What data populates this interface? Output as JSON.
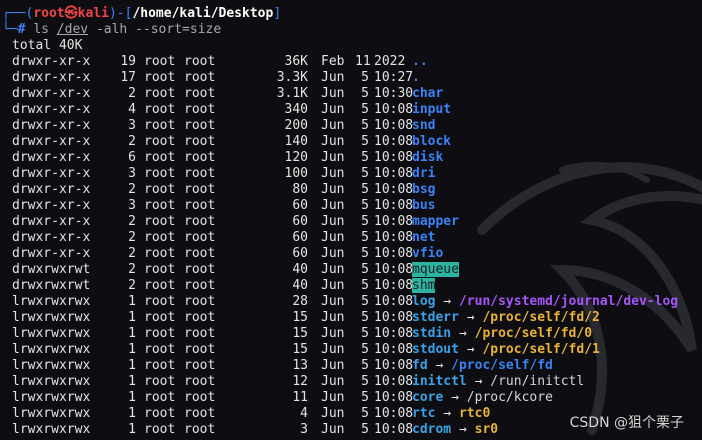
{
  "prompt": {
    "box_top": "┌──(",
    "user": "root",
    "at": "㉿",
    "host": "kali",
    "sep": ")-[",
    "cwd": "/home/kali/Desktop",
    "close": "]",
    "box_bottom": "└─",
    "symbol": "#",
    "command": "ls",
    "arg": "/dev",
    "flags": "-alh",
    "sort": "--sort=size"
  },
  "total": "total 40K",
  "rows": [
    {
      "perm": "drwxr-xr-x",
      "links": "19",
      "owner": "root",
      "group": "root",
      "size": "36K",
      "mon": "Feb",
      "day": "11",
      "time": "2022",
      "name": "..",
      "kind": "dir"
    },
    {
      "perm": "drwxr-xr-x",
      "links": "17",
      "owner": "root",
      "group": "root",
      "size": "3.3K",
      "mon": "Jun",
      "day": "5",
      "time": "10:27",
      "name": ".",
      "kind": "dir"
    },
    {
      "perm": "drwxr-xr-x",
      "links": "2",
      "owner": "root",
      "group": "root",
      "size": "3.1K",
      "mon": "Jun",
      "day": "5",
      "time": "10:30",
      "name": "char",
      "kind": "dir"
    },
    {
      "perm": "drwxr-xr-x",
      "links": "4",
      "owner": "root",
      "group": "root",
      "size": "340",
      "mon": "Jun",
      "day": "5",
      "time": "10:08",
      "name": "input",
      "kind": "dir"
    },
    {
      "perm": "drwxr-xr-x",
      "links": "3",
      "owner": "root",
      "group": "root",
      "size": "200",
      "mon": "Jun",
      "day": "5",
      "time": "10:08",
      "name": "snd",
      "kind": "dir"
    },
    {
      "perm": "drwxr-xr-x",
      "links": "2",
      "owner": "root",
      "group": "root",
      "size": "140",
      "mon": "Jun",
      "day": "5",
      "time": "10:08",
      "name": "block",
      "kind": "dir"
    },
    {
      "perm": "drwxr-xr-x",
      "links": "6",
      "owner": "root",
      "group": "root",
      "size": "120",
      "mon": "Jun",
      "day": "5",
      "time": "10:08",
      "name": "disk",
      "kind": "dir"
    },
    {
      "perm": "drwxr-xr-x",
      "links": "3",
      "owner": "root",
      "group": "root",
      "size": "100",
      "mon": "Jun",
      "day": "5",
      "time": "10:08",
      "name": "dri",
      "kind": "dir"
    },
    {
      "perm": "drwxr-xr-x",
      "links": "2",
      "owner": "root",
      "group": "root",
      "size": "80",
      "mon": "Jun",
      "day": "5",
      "time": "10:08",
      "name": "bsg",
      "kind": "dir"
    },
    {
      "perm": "drwxr-xr-x",
      "links": "3",
      "owner": "root",
      "group": "root",
      "size": "60",
      "mon": "Jun",
      "day": "5",
      "time": "10:08",
      "name": "bus",
      "kind": "dir"
    },
    {
      "perm": "drwxr-xr-x",
      "links": "2",
      "owner": "root",
      "group": "root",
      "size": "60",
      "mon": "Jun",
      "day": "5",
      "time": "10:08",
      "name": "mapper",
      "kind": "dir"
    },
    {
      "perm": "drwxr-xr-x",
      "links": "2",
      "owner": "root",
      "group": "root",
      "size": "60",
      "mon": "Jun",
      "day": "5",
      "time": "10:08",
      "name": "net",
      "kind": "dir"
    },
    {
      "perm": "drwxr-xr-x",
      "links": "2",
      "owner": "root",
      "group": "root",
      "size": "60",
      "mon": "Jun",
      "day": "5",
      "time": "10:08",
      "name": "vfio",
      "kind": "dir"
    },
    {
      "perm": "drwxrwxrwt",
      "links": "2",
      "owner": "root",
      "group": "root",
      "size": "40",
      "mon": "Jun",
      "day": "5",
      "time": "10:08",
      "name": "mqueue",
      "kind": "sticky"
    },
    {
      "perm": "drwxrwxrwt",
      "links": "2",
      "owner": "root",
      "group": "root",
      "size": "40",
      "mon": "Jun",
      "day": "5",
      "time": "10:08",
      "name": "shm",
      "kind": "sticky"
    },
    {
      "perm": "lrwxrwxrwx",
      "links": "1",
      "owner": "root",
      "group": "root",
      "size": "28",
      "mon": "Jun",
      "day": "5",
      "time": "10:08",
      "name": "log",
      "kind": "link",
      "target": "/run/systemd/journal/dev-log",
      "tkind": "link"
    },
    {
      "perm": "lrwxrwxrwx",
      "links": "1",
      "owner": "root",
      "group": "root",
      "size": "15",
      "mon": "Jun",
      "day": "5",
      "time": "10:08",
      "name": "stderr",
      "kind": "link",
      "target": "/proc/self/fd/2",
      "tkind": "dev"
    },
    {
      "perm": "lrwxrwxrwx",
      "links": "1",
      "owner": "root",
      "group": "root",
      "size": "15",
      "mon": "Jun",
      "day": "5",
      "time": "10:08",
      "name": "stdin",
      "kind": "link",
      "target": "/proc/self/fd/0",
      "tkind": "dev"
    },
    {
      "perm": "lrwxrwxrwx",
      "links": "1",
      "owner": "root",
      "group": "root",
      "size": "15",
      "mon": "Jun",
      "day": "5",
      "time": "10:08",
      "name": "stdout",
      "kind": "link",
      "target": "/proc/self/fd/1",
      "tkind": "dev"
    },
    {
      "perm": "lrwxrwxrwx",
      "links": "1",
      "owner": "root",
      "group": "root",
      "size": "13",
      "mon": "Jun",
      "day": "5",
      "time": "10:08",
      "name": "fd",
      "kind": "link",
      "target": "/proc/self/fd",
      "tkind": "dir"
    },
    {
      "perm": "lrwxrwxrwx",
      "links": "1",
      "owner": "root",
      "group": "root",
      "size": "12",
      "mon": "Jun",
      "day": "5",
      "time": "10:08",
      "name": "initctl",
      "kind": "link",
      "target": "/run/initctl",
      "tkind": "plain"
    },
    {
      "perm": "lrwxrwxrwx",
      "links": "1",
      "owner": "root",
      "group": "root",
      "size": "11",
      "mon": "Jun",
      "day": "5",
      "time": "10:08",
      "name": "core",
      "kind": "link",
      "target": "/proc/kcore",
      "tkind": "plain"
    },
    {
      "perm": "lrwxrwxrwx",
      "links": "1",
      "owner": "root",
      "group": "root",
      "size": "4",
      "mon": "Jun",
      "day": "5",
      "time": "10:08",
      "name": "rtc",
      "kind": "link",
      "target": "rtc0",
      "tkind": "dev"
    },
    {
      "perm": "lrwxrwxrwx",
      "links": "1",
      "owner": "root",
      "group": "root",
      "size": "3",
      "mon": "Jun",
      "day": "5",
      "time": "10:08",
      "name": "cdrom",
      "kind": "link",
      "target": "sr0",
      "tkind": "dev"
    }
  ],
  "arrow": "→",
  "watermark": "CSDN @狙个栗子",
  "colors": {
    "background": "#0e0e12",
    "directory": "#3b82f6",
    "sticky_bg": "#2bb5a0",
    "symlink": "#3aa2e6",
    "device": "#e8b23a",
    "broken_or_symlink_target": "#a855f7",
    "root_user": "#ef4444"
  }
}
